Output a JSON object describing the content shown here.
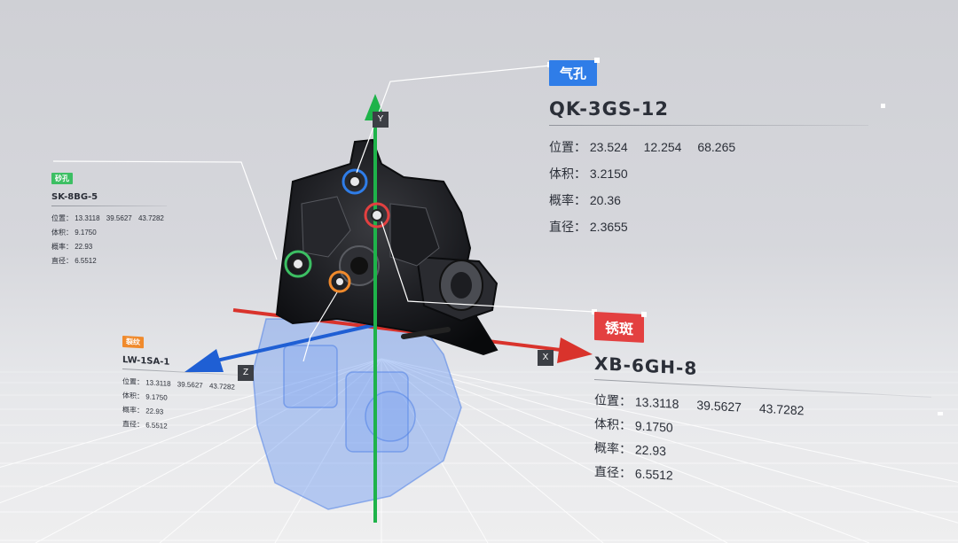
{
  "axes": {
    "x": "X",
    "y": "Y",
    "z": "Z"
  },
  "colors": {
    "x_axis": "#d9332c",
    "y_axis": "#1eb34a",
    "z_axis": "#1f5fd4",
    "tag_blue": "#2f7de8",
    "tag_red": "#e34040",
    "tag_green": "#3cbf63",
    "tag_orange": "#f08a2c"
  },
  "panels": {
    "qikong": {
      "tag": "气孔",
      "code": "QK-3GS-12",
      "position_label": "位置：",
      "position": [
        "23.524",
        "12.254",
        "68.265"
      ],
      "volume_label": "体积：",
      "volume": "3.2150",
      "probability_label": "概率：",
      "probability": "20.36",
      "diameter_label": "直径：",
      "diameter": "2.3655"
    },
    "xiuban": {
      "tag": "锈斑",
      "code": "XB-6GH-8",
      "position_label": "位置：",
      "position": [
        "13.3118",
        "39.5627",
        "43.7282"
      ],
      "volume_label": "体积：",
      "volume": "9.1750",
      "probability_label": "概率：",
      "probability": "22.93",
      "diameter_label": "直径：",
      "diameter": "6.5512"
    },
    "small1": {
      "tag": "砂孔",
      "code": "SK-8BG-5",
      "position_label": "位置：",
      "position": [
        "13.3118",
        "39.5627",
        "43.7282"
      ],
      "volume_label": "体积：",
      "volume": "9.1750",
      "probability_label": "概率：",
      "probability": "22.93",
      "diameter_label": "直径：",
      "diameter": "6.5512"
    },
    "small2": {
      "tag": "裂纹",
      "code": "LW-1SA-1",
      "position_label": "位置：",
      "position": [
        "13.3118",
        "39.5627",
        "43.7282"
      ],
      "volume_label": "体积：",
      "volume": "9.1750",
      "probability_label": "概率：",
      "probability": "22.93",
      "diameter_label": "直径：",
      "diameter": "6.5512"
    }
  }
}
